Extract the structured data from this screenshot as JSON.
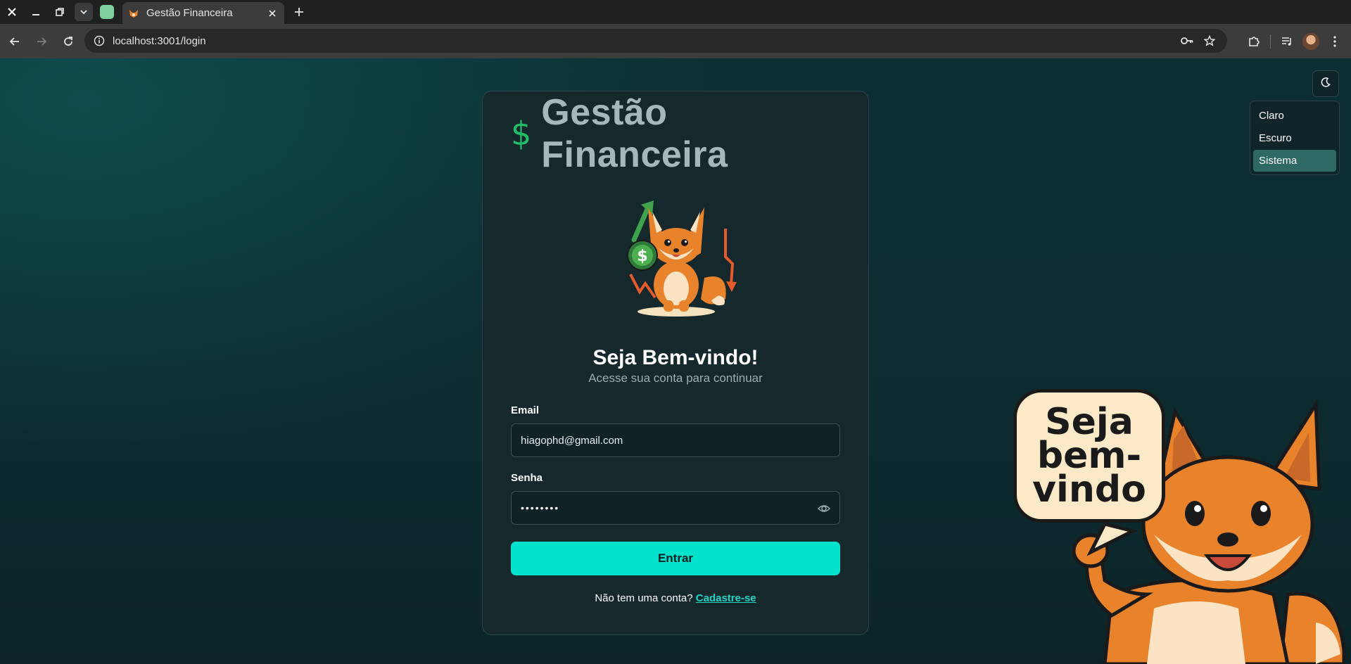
{
  "browser": {
    "tab_title": "Gestão Financeira",
    "url": "localhost:3001/login"
  },
  "app": {
    "brand_symbol": "$",
    "brand_name": "Gestão Financeira",
    "welcome_title": "Seja Bem-vindo!",
    "welcome_subtitle": "Acesse sua conta para continuar",
    "email_label": "Email",
    "email_value": "hiagophd@gmail.com",
    "password_label": "Senha",
    "password_value": "••••••••",
    "login_button": "Entrar",
    "signup_prompt": "Não tem uma conta?",
    "signup_link": "Cadastre-se"
  },
  "theme_menu": {
    "icon": "moon-icon",
    "items": [
      {
        "label": "Claro",
        "selected": false
      },
      {
        "label": "Escuro",
        "selected": false
      },
      {
        "label": "Sistema",
        "selected": true
      }
    ]
  },
  "mascot_bubble": {
    "lines": [
      "Seja",
      "bem-",
      "vindo"
    ]
  },
  "colors": {
    "accent": "#00e2cc",
    "brand_dollar": "#1fbf6a",
    "selected_item": "#2e6a63",
    "card_bg": "#15292d"
  }
}
